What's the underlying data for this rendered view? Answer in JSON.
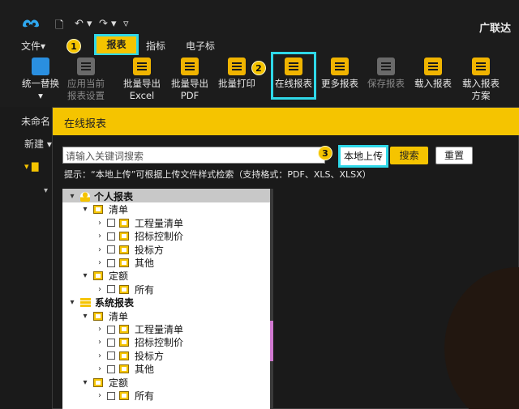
{
  "titlebar": {
    "quick_access": [
      "🗋",
      "↶ ▾",
      "↷ ▾",
      "▿"
    ],
    "app_title": "广联达"
  },
  "menu": {
    "file": "文件▾",
    "partial": "编",
    "report": "报表",
    "index": "指标",
    "etender": "电子标"
  },
  "ribbon": {
    "items": [
      {
        "label1": "统一替换",
        "label2": "▾",
        "icon": "replace-icon"
      },
      {
        "label1": "应用当前",
        "label2": "报表设置",
        "icon": "apply-settings-icon"
      },
      {
        "label1": "批量导出",
        "label2": "Excel",
        "icon": "export-excel-icon"
      },
      {
        "label1": "批量导出",
        "label2": "PDF",
        "icon": "export-pdf-icon"
      },
      {
        "label1": "批量打印",
        "label2": "",
        "icon": "print-icon"
      },
      {
        "label1": "在线报表",
        "label2": "",
        "icon": "online-report-icon"
      },
      {
        "label1": "更多报表",
        "label2": "",
        "icon": "more-reports-icon"
      },
      {
        "label1": "保存报表",
        "label2": "",
        "icon": "save-report-icon"
      },
      {
        "label1": "载入报表",
        "label2": "",
        "icon": "load-report-icon"
      },
      {
        "label1": "载入报表",
        "label2": "方案",
        "icon": "load-scheme-icon"
      }
    ]
  },
  "badges": [
    "1",
    "2",
    "3"
  ],
  "leftbar": {
    "unnamed": "未命名",
    "new": "新建 ▾"
  },
  "dialog": {
    "title": "在线报表",
    "search_placeholder": "请输入关键词搜索",
    "local_upload": "本地上传",
    "search": "搜索",
    "reset": "重置",
    "tip": "提示：“本地上传”可根据上传文件样式检索（支持格式：PDF、XLS、XLSX）"
  },
  "tree": [
    {
      "label": "个人报表",
      "type": "person"
    },
    {
      "label": "清单",
      "type": "folder"
    },
    {
      "label": "工程量清单",
      "type": "item"
    },
    {
      "label": "招标控制价",
      "type": "item"
    },
    {
      "label": "投标方",
      "type": "item"
    },
    {
      "label": "其他",
      "type": "item"
    },
    {
      "label": "定额",
      "type": "folder"
    },
    {
      "label": "所有",
      "type": "item"
    },
    {
      "label": "系统报表",
      "type": "stack"
    },
    {
      "label": "清单",
      "type": "folder"
    },
    {
      "label": "工程量清单",
      "type": "item"
    },
    {
      "label": "招标控制价",
      "type": "item"
    },
    {
      "label": "投标方",
      "type": "item"
    },
    {
      "label": "其他",
      "type": "item"
    },
    {
      "label": "定额",
      "type": "folder"
    },
    {
      "label": "所有",
      "type": "item"
    }
  ],
  "colors": {
    "accent": "#f5c400",
    "highlight": "#2fd8e8"
  }
}
